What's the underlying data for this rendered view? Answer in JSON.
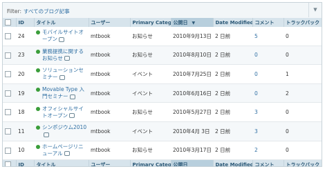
{
  "filter": {
    "label": "Filter:",
    "value": "すべてのブログ記事",
    "toggle_icon": "▼"
  },
  "columns": {
    "id": "ID",
    "title": "タイトル",
    "user": "ユーザー",
    "category": "Primary Category",
    "published": "公開日",
    "sort_arrow": "▼",
    "modified": "Date Modified",
    "comments": "コメント",
    "trackbacks": "トラックバック"
  },
  "rows": [
    {
      "id": "24",
      "title": "モバイルサイトオープン",
      "user": "mtbook",
      "category": "お知らせ",
      "published": "2010年9月13日",
      "modified": "2 日前",
      "comments": "5",
      "trackbacks": "0"
    },
    {
      "id": "23",
      "title": "業務提携に関するお知らせ",
      "user": "mtbook",
      "category": "お知らせ",
      "published": "2010年8月10日",
      "modified": "2 日前",
      "comments": "0",
      "trackbacks": "0"
    },
    {
      "id": "20",
      "title": "ソリューションセミナー",
      "user": "mtbook",
      "category": "イベント",
      "published": "2010年7月25日",
      "modified": "2 日前",
      "comments": "0",
      "trackbacks": "1"
    },
    {
      "id": "19",
      "title": "Movable Type 入門セミナー",
      "user": "mtbook",
      "category": "イベント",
      "published": "2010年6月16日",
      "modified": "2 日前",
      "comments": "0",
      "trackbacks": "2"
    },
    {
      "id": "18",
      "title": "オフィシャルサイトオープン",
      "user": "mtbook",
      "category": "お知らせ",
      "published": "2010年5月27日",
      "modified": "2 日前",
      "comments": "3",
      "trackbacks": "0"
    },
    {
      "id": "11",
      "title": "シンポジウム2010",
      "user": "mtbook",
      "category": "イベント",
      "published": "2010年4月 3日",
      "modified": "2 日前",
      "comments": "3",
      "trackbacks": "0"
    },
    {
      "id": "10",
      "title": "ホームページリニューアル",
      "user": "mtbook",
      "category": "お知らせ",
      "published": "2010年3月17日",
      "modified": "2 日前",
      "comments": "2",
      "trackbacks": "0"
    }
  ]
}
